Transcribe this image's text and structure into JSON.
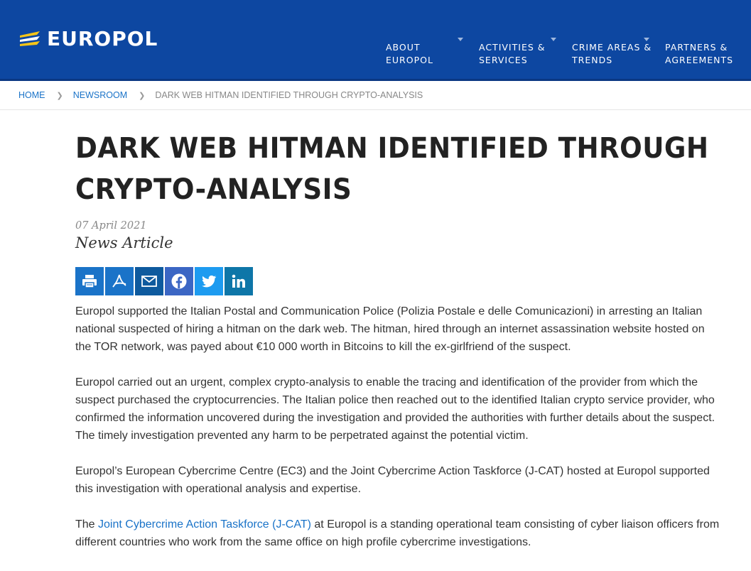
{
  "header": {
    "logo_text": "EUROPOL",
    "nav": [
      {
        "label": "ABOUT\nEUROPOL"
      },
      {
        "label": "ACTIVITIES &\nSERVICES"
      },
      {
        "label": "CRIME AREAS &\nTRENDS"
      },
      {
        "label": "PARTNERS &\nAGREEMENTS"
      }
    ]
  },
  "breadcrumb": {
    "home": "HOME",
    "newsroom": "NEWSROOM",
    "current": "DARK WEB HITMAN IDENTIFIED THROUGH CRYPTO-ANALYSIS"
  },
  "article": {
    "title": "DARK WEB HITMAN IDENTIFIED THROUGH CRYPTO-ANALYSIS",
    "date": "07 April 2021",
    "type": "News Article",
    "share_buttons": [
      {
        "icon": "print-icon",
        "color": "#1a73c8"
      },
      {
        "icon": "pdf-icon",
        "color": "#1a73c8"
      },
      {
        "icon": "email-icon",
        "color": "#0e5a9e"
      },
      {
        "icon": "facebook-icon",
        "color": "#3b66c4"
      },
      {
        "icon": "twitter-icon",
        "color": "#1d9bf0"
      },
      {
        "icon": "linkedin-icon",
        "color": "#0e76a8"
      }
    ],
    "p1": "Europol supported the Italian Postal and Communication Police (Polizia Postale e delle Comunicazioni) in arresting an Italian national suspected of hiring a hitman on the dark web. The hitman, hired through an internet assassination website hosted on the TOR network, was payed about €10 000 worth in Bitcoins to kill the ex-girlfriend of the suspect.",
    "p2": "Europol carried out an urgent, complex crypto-analysis to enable the tracing and identification of the provider from which the suspect purchased the cryptocurrencies. The Italian police then reached out to the identified Italian crypto service provider, who confirmed the information uncovered during the investigation and provided the authorities with further details about the suspect. The timely investigation prevented any harm to be perpetrated against the potential victim.",
    "p3": "Europol’s European Cybercrime Centre (EC3) and the Joint Cybercrime Action Taskforce (J-CAT) hosted at Europol supported this investigation with operational analysis and expertise.",
    "p4_pre": "The ",
    "p4_link": "Joint Cybercrime Action Taskforce (J-CAT)",
    "p4_post": " at Europol is a standing operational team consisting of cyber liaison officers from different countries who work from the same office on high profile cybercrime investigations."
  },
  "colors": {
    "header_bg": "#0d47a1",
    "link": "#1a73c8",
    "logo_accent": "#f5c518"
  }
}
